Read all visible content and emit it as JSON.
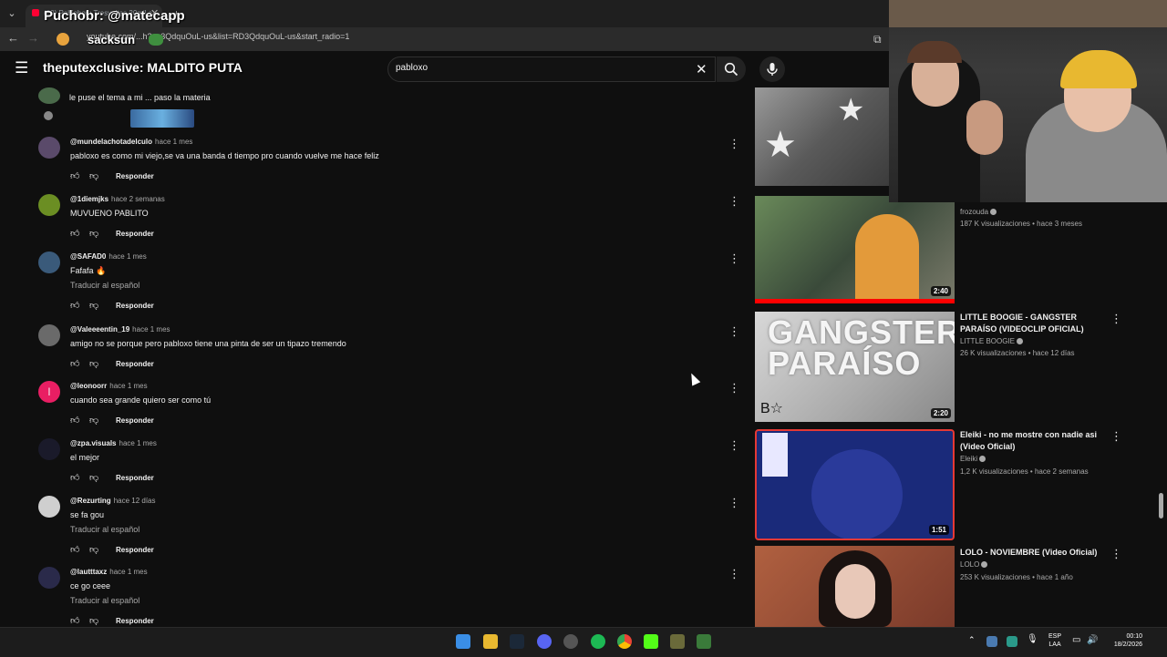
{
  "browser": {
    "tab_title": "(20) Pablobom Tresvaltas 20mil c",
    "address": "youtube.com/...h?v=3QdquOuL-us&list=RD3QdquOuL-us&start_radio=1",
    "chat_overlay_line1": "Puchobr: @matecapp",
    "chat_overlay_line2": "sacksun",
    "chat_overlay_line3": "theputexclusive: MALDITO PUTA"
  },
  "search": {
    "value": "pabloxo"
  },
  "comments": [
    {
      "user": "@mundelachotadelculo",
      "time": "hace 1 mes",
      "text": "pabloxo es como mi viejo,se va una banda d tiempo pro cuando vuelve me hace feliz",
      "translate": "",
      "reply": "Responder",
      "avatar_color": "#5a4a6a"
    },
    {
      "user": "@1diemjks",
      "time": "hace 2 semanas",
      "text": "MUVUENO PABLITO",
      "translate": "",
      "reply": "Responder",
      "avatar_color": "#6b8e23"
    },
    {
      "user": "@SAFAD0",
      "time": "hace 1 mes",
      "text": "Fafafa 🔥",
      "translate": "Traducir al español",
      "reply": "Responder",
      "avatar_color": "#3a5a7a"
    },
    {
      "user": "@Valeeeentin_19",
      "time": "hace 1 mes",
      "text": "amigo no se porque pero pabloxo tiene una pinta de ser un tipazo tremendo",
      "translate": "",
      "reply": "Responder",
      "avatar_color": "#6a6a6a"
    },
    {
      "user": "@leonoorr",
      "time": "hace 1 mes",
      "text": "cuando sea grande quiero ser como tú",
      "translate": "",
      "reply": "Responder",
      "avatar_color": "#e91e63",
      "avatar_letter": "l"
    },
    {
      "user": "@zpa.visuals",
      "time": "hace 1 mes",
      "text": "el mejor",
      "translate": "",
      "reply": "Responder",
      "avatar_color": "#1a1a2a"
    },
    {
      "user": "@Rezurting",
      "time": "hace 12 días",
      "text": "se fa gou",
      "translate": "Traducir al español",
      "reply": "Responder",
      "avatar_color": "#cfcfcf"
    },
    {
      "user": "@lautttaxz",
      "time": "hace 1 mes",
      "text": "ce go ceee",
      "translate": "Traducir al español",
      "reply": "Responder",
      "avatar_color": "#2a2a4a"
    }
  ],
  "top_comment_fragment": "le puse el tema a mi ... paso la materia",
  "sidebar": [
    {
      "title": "",
      "channel": "frozouda",
      "meta": "187 K visualizaciones • hace 3 meses",
      "duration": "2:40"
    },
    {
      "title": "LITTLE BOOGIE - GANGSTER PARAÍSO (VIDEOCLIP OFICIAL)",
      "channel": "LITTLE BOOGIE",
      "meta": "26 K visualizaciones • hace 12 días",
      "duration": "2:20",
      "thumb_text": "GANGSTER PARAÍSO"
    },
    {
      "title": "Eleiki - no me mostre con nadie asi (Video Oficial)",
      "channel": "Eleiki",
      "meta": "1,2 K visualizaciones • hace 2 semanas",
      "duration": "1:51"
    },
    {
      "title": "LOLO - NOVIEMBRE (Video Oficial)",
      "channel": "LOLO",
      "meta": "253 K visualizaciones • hace 1 año",
      "duration": ""
    }
  ],
  "tray": {
    "lang1": "ESP",
    "lang2": "LAA",
    "time": "00:10",
    "date": "18/2/2026"
  },
  "icons": {
    "menu": "hamburger-icon",
    "search": "search-icon",
    "mic": "mic-icon",
    "clear": "close-icon"
  }
}
